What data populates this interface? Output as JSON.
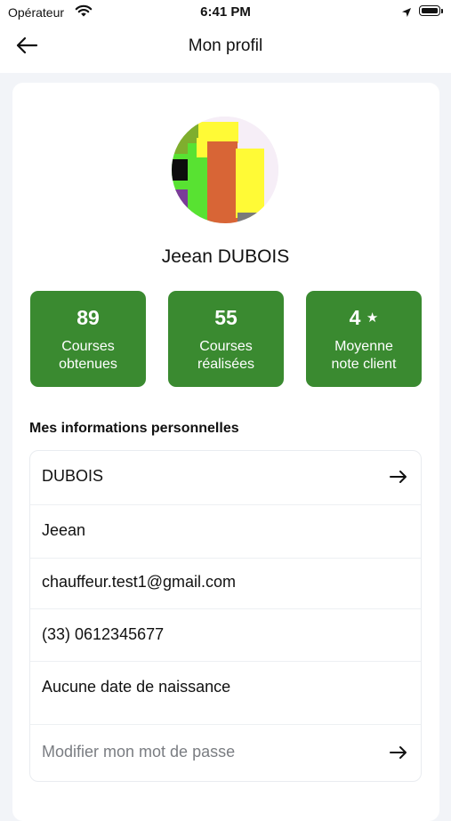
{
  "status_bar": {
    "carrier": "Opérateur",
    "time": "6:41 PM"
  },
  "header": {
    "title": "Mon profil"
  },
  "profile": {
    "name": "Jeean DUBOIS"
  },
  "stats": [
    {
      "value": "89",
      "label_line1": "Courses",
      "label_line2": "obtenues"
    },
    {
      "value": "55",
      "label_line1": "Courses",
      "label_line2": "réalisées"
    },
    {
      "value": "4",
      "star": "★",
      "label_line1": "Moyenne",
      "label_line2": "note client"
    }
  ],
  "personal_info": {
    "title": "Mes informations personnelles",
    "last_name": "DUBOIS",
    "first_name": "Jeean",
    "email": "chauffeur.test1@gmail.com",
    "phone": "(33) 0612345677",
    "birthdate": "Aucune date de naissance",
    "change_password": "Modifier mon mot de passe"
  },
  "colors": {
    "accent_green": "#3a8a30",
    "background": "#f2f4f8"
  },
  "icons": {
    "back": "arrow-left-icon",
    "row": "arrow-right-icon",
    "wifi": "wifi-icon",
    "location": "location-arrow-icon",
    "battery": "battery-icon"
  }
}
